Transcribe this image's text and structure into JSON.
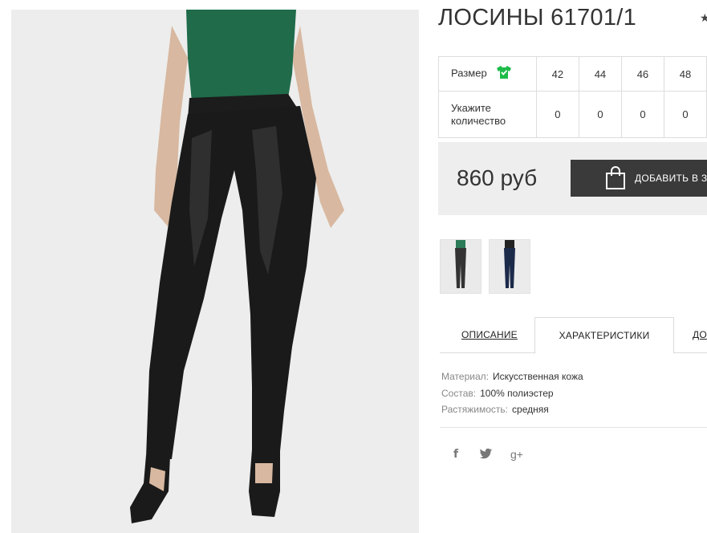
{
  "product": {
    "title": "ЛОСИНЫ 61701/1",
    "price": "860 руб",
    "add_to_cart": "ДОБАВИТЬ В З"
  },
  "size_table": {
    "size_label": "Размер",
    "qty_label_line1": "Укажите",
    "qty_label_line2": "количество",
    "sizes": [
      "42",
      "44",
      "46",
      "48"
    ],
    "quantities": [
      "0",
      "0",
      "0",
      "0"
    ]
  },
  "tabs": {
    "description": "ОПИСАНИЕ",
    "specs": "ХАРАКТЕРИСТИКИ",
    "more": "ДО"
  },
  "specs": [
    {
      "key": "Материал:",
      "value": "Искусственная кожа"
    },
    {
      "key": "Состав:",
      "value": "100% полиэстер"
    },
    {
      "key": "Растяжимость:",
      "value": "средняя"
    }
  ],
  "social": {
    "facebook": "f",
    "twitter": "twitter-icon",
    "google_plus": "g+"
  },
  "colors": {
    "accent_green": "#1ebc4a",
    "button_dark": "#3a3a3a",
    "price_bg": "#eeeeee"
  }
}
